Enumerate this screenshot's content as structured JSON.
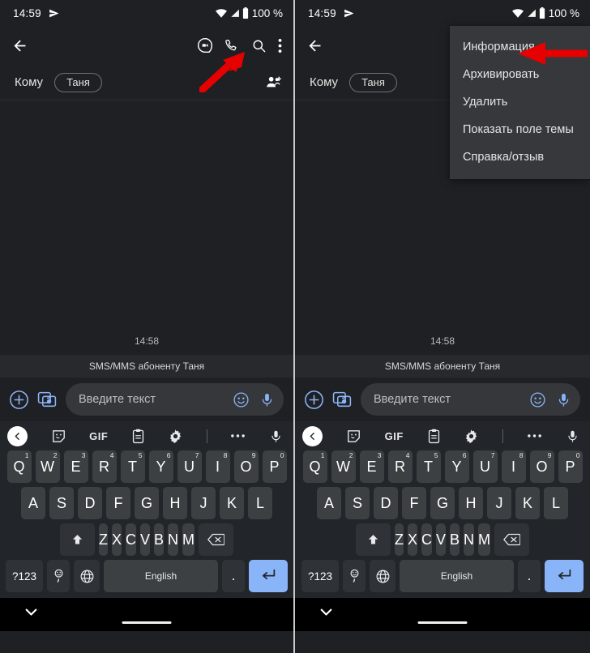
{
  "status_bar": {
    "time": "14:59",
    "battery_text": "100 %",
    "icons": [
      "telegram-send-icon",
      "wifi-icon",
      "signal-slash-icon",
      "battery-icon"
    ]
  },
  "app_bar": {
    "back_icon": "back-arrow-icon",
    "actions": [
      "video-call-icon",
      "phone-call-icon",
      "search-icon",
      "overflow-menu-icon"
    ]
  },
  "recipient_row": {
    "label": "Кому",
    "chip": "Таня",
    "add_person_icon": "add-person-icon"
  },
  "conversation": {
    "timestamp": "14:58",
    "sms_banner": "SMS/MMS абоненту Таня"
  },
  "compose": {
    "plus_icon": "plus-circle-icon",
    "gallery_icon": "gallery-camera-icon",
    "placeholder": "Введите текст",
    "emoji_icon": "emoji-icon",
    "mic_icon": "microphone-icon"
  },
  "keyboard": {
    "toolbar": {
      "back_icon": "chevron-left-icon",
      "sticker_icon": "sticker-icon",
      "gif_label": "GIF",
      "clipboard_icon": "clipboard-icon",
      "settings_icon": "gear-icon",
      "more_icon": "more-dots-icon",
      "mic_icon": "microphone-icon"
    },
    "row1": [
      {
        "letter": "Q",
        "num": "1"
      },
      {
        "letter": "W",
        "num": "2"
      },
      {
        "letter": "E",
        "num": "3"
      },
      {
        "letter": "R",
        "num": "4"
      },
      {
        "letter": "T",
        "num": "5"
      },
      {
        "letter": "Y",
        "num": "6"
      },
      {
        "letter": "U",
        "num": "7"
      },
      {
        "letter": "I",
        "num": "8"
      },
      {
        "letter": "O",
        "num": "9"
      },
      {
        "letter": "P",
        "num": "0"
      }
    ],
    "row2": [
      "A",
      "S",
      "D",
      "F",
      "G",
      "H",
      "J",
      "K",
      "L"
    ],
    "row3": [
      "Z",
      "X",
      "C",
      "V",
      "B",
      "N",
      "M"
    ],
    "shift_icon": "shift-up-icon",
    "backspace_icon": "backspace-icon",
    "symbols_label": "?123",
    "comma_label": ",",
    "comma_emoji_icon": "emoji-small-icon",
    "globe_icon": "globe-language-icon",
    "space_label": "English",
    "period_label": ".",
    "enter_icon": "enter-return-icon"
  },
  "nav_bar": {
    "dismiss_keyboard_icon": "chevron-down-icon",
    "home_indicator": "home-pill"
  },
  "overflow_menu": {
    "items": [
      "Информация",
      "Архивировать",
      "Удалить",
      "Показать поле темы",
      "Справка/отзыв"
    ]
  },
  "annotations": {
    "arrow_color": "#e60000",
    "left_arrow_target": "overflow-menu-icon",
    "right_arrow_target": "Информация"
  },
  "colors": {
    "app_background": "#1f2023",
    "keyboard_background": "#22262b",
    "key_background": "#3c4043",
    "accent_blue": "#8ab4f8",
    "menu_background": "#37383b",
    "sms_banner_background": "#27292c"
  }
}
